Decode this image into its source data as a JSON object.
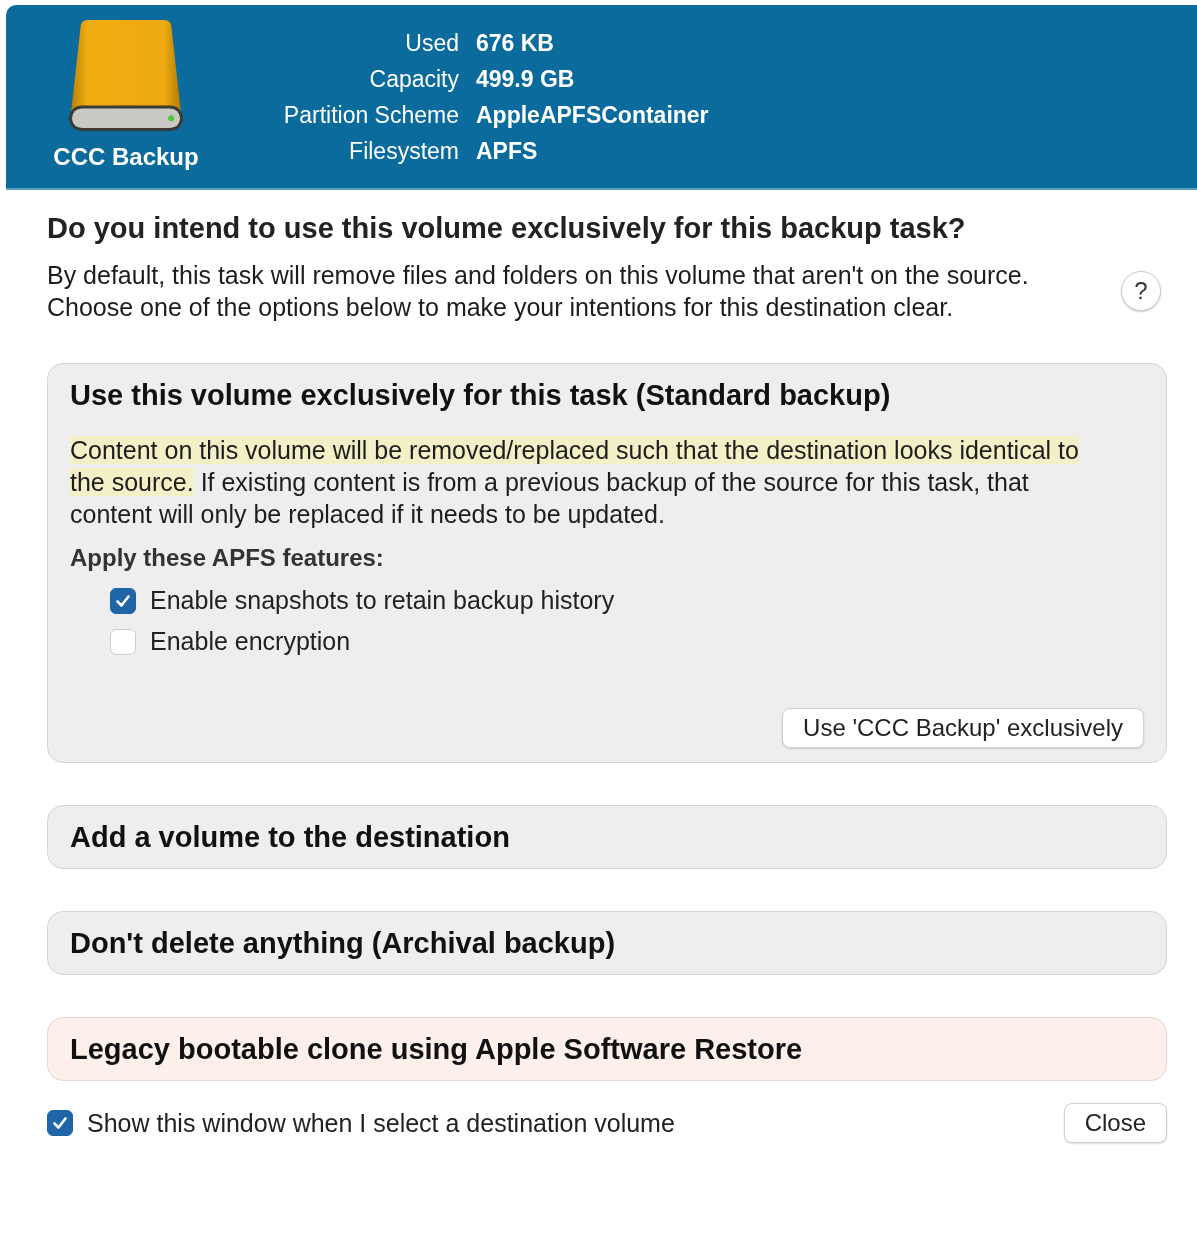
{
  "volume": {
    "name": "CCC Backup",
    "properties": [
      {
        "label": "Used",
        "value": "676 KB"
      },
      {
        "label": "Capacity",
        "value": "499.9 GB"
      },
      {
        "label": "Partition Scheme",
        "value": "AppleAPFSContainer"
      },
      {
        "label": "Filesystem",
        "value": "APFS"
      }
    ]
  },
  "question": {
    "title": "Do you intend to use this volume exclusively for this backup task?",
    "text": "By default, this task will remove files and folders on this volume that aren't on the source. Choose one of the options below to make your intentions for this destination clear.",
    "help_button": "?"
  },
  "options": [
    {
      "kind": "normal",
      "expanded": true,
      "title": "Use this volume exclusively for this task (Standard backup)",
      "highlight": "Content on this volume will be removed/replaced such that the destination looks identical to the source.",
      "text": " If existing content is from a previous backup of the source for this task, that content will only be replaced if it needs to be updated.",
      "features_label": "Apply these APFS features:",
      "features": [
        {
          "label": "Enable snapshots to retain backup history",
          "checked": true
        },
        {
          "label": "Enable encryption",
          "checked": false
        }
      ],
      "button": "Use 'CCC Backup' exclusively"
    },
    {
      "kind": "normal",
      "expanded": false,
      "title": "Add a volume to the destination"
    },
    {
      "kind": "normal",
      "expanded": false,
      "title": "Don't delete anything (Archival backup)"
    },
    {
      "kind": "legacy",
      "expanded": false,
      "title": "Legacy bootable clone using Apple Software Restore"
    }
  ],
  "footer": {
    "show_window": {
      "label": "Show this window when I select a destination volume",
      "checked": true
    },
    "close_button": "Close"
  }
}
